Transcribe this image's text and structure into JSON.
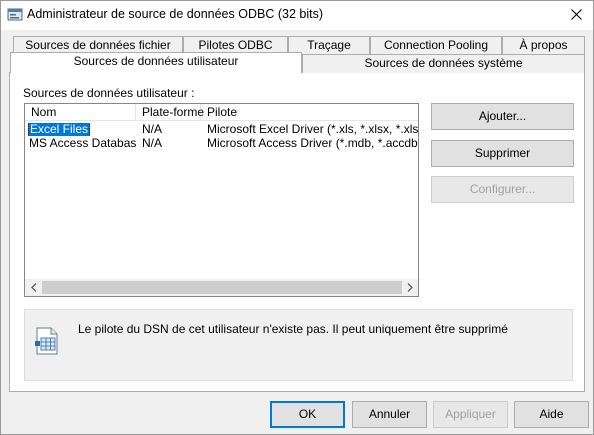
{
  "window": {
    "title": "Administrateur de source de données ODBC (32 bits)"
  },
  "tabs_back": [
    {
      "label": "Sources de données fichier"
    },
    {
      "label": "Pilotes ODBC"
    },
    {
      "label": "Traçage"
    },
    {
      "label": "Connection Pooling"
    },
    {
      "label": "À propos"
    }
  ],
  "tabs_front": [
    {
      "label": "Sources de données utilisateur",
      "active": true
    },
    {
      "label": "Sources de données système",
      "active": false
    }
  ],
  "group_label": "Sources de données utilisateur :",
  "listview": {
    "columns": [
      "Nom",
      "Plate-forme",
      "Pilote"
    ],
    "rows": [
      {
        "name": "Excel Files",
        "platform": "N/A",
        "driver": "Microsoft Excel Driver (*.xls, *.xlsx, *.xlsm, *.xlsb)",
        "selected": true
      },
      {
        "name": "MS Access Database",
        "platform": "N/A",
        "driver": "Microsoft Access Driver (*.mdb, *.accdb)",
        "selected": false
      }
    ]
  },
  "side_buttons": {
    "add": "Ajouter...",
    "remove": "Supprimer",
    "configure": "Configurer..."
  },
  "info": {
    "message": "Le pilote du DSN de cet utilisateur n'existe pas. Il peut uniquement être supprimé"
  },
  "footer_buttons": {
    "ok": "OK",
    "cancel": "Annuler",
    "apply": "Appliquer",
    "help": "Aide"
  },
  "icons": {
    "title": "odbc-app-icon",
    "close": "close-icon",
    "info": "datasource-document-icon",
    "scroll_left": "chevron-left-icon",
    "scroll_right": "chevron-right-icon"
  },
  "colors": {
    "selection": "#0078d7",
    "window_bg": "#f0f0f0",
    "panel_bg": "#ffffff"
  }
}
